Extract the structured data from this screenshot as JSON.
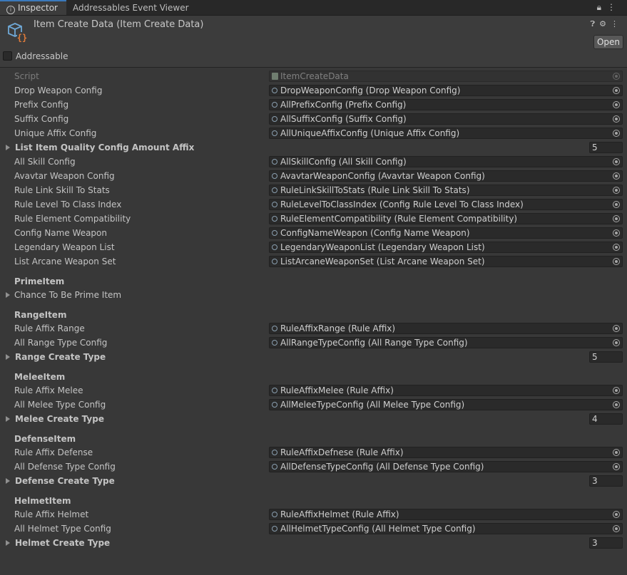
{
  "tabs": [
    {
      "label": "Inspector"
    },
    {
      "label": "Addressables Event Viewer"
    }
  ],
  "header": {
    "title": "Item Create Data (Item Create Data)",
    "open_label": "Open",
    "addressable_label": "Addressable",
    "addressable_checked": false
  },
  "rows": [
    {
      "type": "object",
      "label": "Script",
      "value": "ItemCreateData",
      "disabled": true
    },
    {
      "type": "object",
      "label": "Drop Weapon Config",
      "value": "DropWeaponConfig (Drop Weapon Config)"
    },
    {
      "type": "object",
      "label": "Prefix Config",
      "value": "AllPrefixConfig (Prefix Config)"
    },
    {
      "type": "object",
      "label": "Suffix Config",
      "value": "AllSuffixConfig (Suffix Config)"
    },
    {
      "type": "object",
      "label": "Unique Affix Config",
      "value": "AllUniqueAffixConfig (Unique Affix Config)"
    },
    {
      "type": "list",
      "label": "List Item Quality Config Amount Affix",
      "value": "5"
    },
    {
      "type": "object",
      "label": "All Skill Config",
      "value": "AllSkillConfig (All Skill Config)"
    },
    {
      "type": "object",
      "label": "Avavtar Weapon Config",
      "value": "AvavtarWeaponConfig (Avavtar Weapon Config)"
    },
    {
      "type": "object",
      "label": "Rule Link Skill To Stats",
      "value": "RuleLinkSkillToStats (Rule Link Skill To Stats)"
    },
    {
      "type": "object",
      "label": "Rule Level To Class Index",
      "value": "RuleLevelToClassIndex (Config Rule Level To Class Index)"
    },
    {
      "type": "object",
      "label": "Rule Element Compatibility",
      "value": "RuleElementCompatibility (Rule Element Compatibility)"
    },
    {
      "type": "object",
      "label": "Config Name Weapon",
      "value": "ConfigNameWeapon (Config Name Weapon)"
    },
    {
      "type": "object",
      "label": "Legendary Weapon List",
      "value": "LegendaryWeaponList (Legendary Weapon List)"
    },
    {
      "type": "object",
      "label": "List Arcane Weapon Set",
      "value": "ListArcaneWeaponSet (List Arcane Weapon Set)"
    },
    {
      "type": "header",
      "label": "PrimeItem"
    },
    {
      "type": "foldout",
      "label": "Chance To Be Prime Item"
    },
    {
      "type": "header",
      "label": "RangeItem"
    },
    {
      "type": "object",
      "label": "Rule Affix Range",
      "value": "RuleAffixRange (Rule Affix)"
    },
    {
      "type": "object",
      "label": "All Range Type Config",
      "value": "AllRangeTypeConfig (All Range Type Config)"
    },
    {
      "type": "list",
      "label": "Range Create Type",
      "value": "5"
    },
    {
      "type": "header",
      "label": "MeleeItem"
    },
    {
      "type": "object",
      "label": "Rule Affix Melee",
      "value": "RuleAffixMelee (Rule Affix)"
    },
    {
      "type": "object",
      "label": "All Melee Type Config",
      "value": "AllMeleeTypeConfig (All Melee Type Config)"
    },
    {
      "type": "list",
      "label": "Melee Create Type",
      "value": "4"
    },
    {
      "type": "header",
      "label": "DefenseItem"
    },
    {
      "type": "object",
      "label": "Rule Affix Defense",
      "value": "RuleAffixDefnese (Rule Affix)"
    },
    {
      "type": "object",
      "label": "All Defense Type Config",
      "value": "AllDefenseTypeConfig (All Defense Type Config)"
    },
    {
      "type": "list",
      "label": "Defense Create Type",
      "value": "3"
    },
    {
      "type": "header",
      "label": "HelmetItem"
    },
    {
      "type": "object",
      "label": "Rule Affix Helmet",
      "value": "RuleAffixHelmet (Rule Affix)"
    },
    {
      "type": "object",
      "label": "All Helmet Type Config",
      "value": "AllHelmetTypeConfig (All Helmet Type Config)"
    },
    {
      "type": "list",
      "label": "Helmet Create Type",
      "value": "3"
    }
  ]
}
